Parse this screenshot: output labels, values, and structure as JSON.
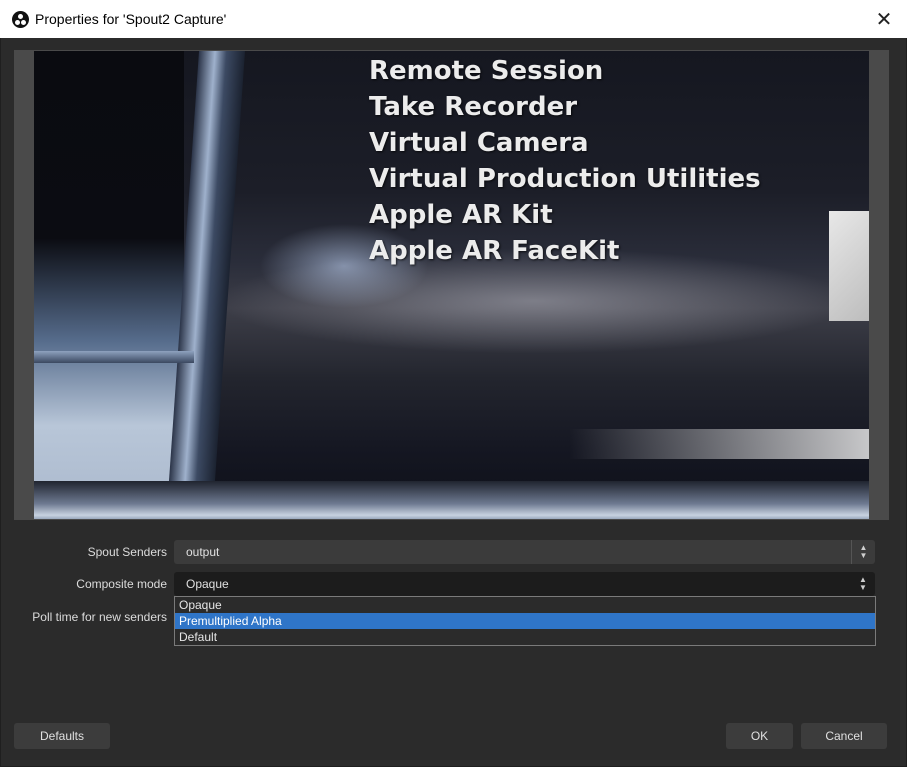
{
  "window": {
    "title": "Properties for 'Spout2 Capture'",
    "close_glyph": "✕",
    "app_icon": "obs-icon"
  },
  "preview": {
    "menu_items": [
      "Remote Session",
      "Take Recorder",
      "Virtual Camera",
      "Virtual Production Utilities",
      "Apple AR Kit",
      "Apple AR FaceKit"
    ]
  },
  "form": {
    "spout_senders": {
      "label": "Spout Senders",
      "value": "output"
    },
    "composite_mode": {
      "label": "Composite mode",
      "value": "Opaque"
    },
    "poll_time": {
      "label": "Poll time for new senders"
    }
  },
  "dropdown": {
    "options": [
      "Opaque",
      "Premultiplied Alpha",
      "Default"
    ],
    "highlighted": "Premultiplied Alpha"
  },
  "buttons": {
    "defaults": "Defaults",
    "ok": "OK",
    "cancel": "Cancel"
  },
  "colors": {
    "highlight": "#2f75c8",
    "background": "#2b2b2b",
    "titlebar": "#ffffff"
  }
}
